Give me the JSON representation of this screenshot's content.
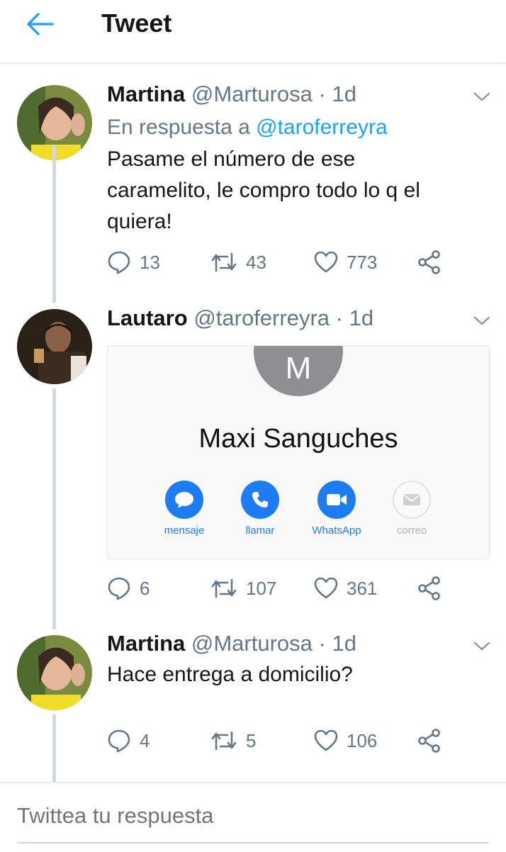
{
  "header": {
    "title": "Tweet"
  },
  "tweets": [
    {
      "name": "Martina",
      "handle": "@Marturosa",
      "dot": "·",
      "time": "1d",
      "reply_prefix": "En respuesta a",
      "reply_handle": "@taroferreyra",
      "lines": [
        "Pasame el número de ese",
        "caramelito, le compro todo lo q el",
        "quiera!"
      ],
      "replies": "13",
      "retweets": "43",
      "likes": "773"
    },
    {
      "name": "Lautaro",
      "handle": "@taroferreyra",
      "dot": "·",
      "time": "1d",
      "card": {
        "initial": "M",
        "contact_name": "Maxi Sanguches",
        "buttons": [
          "mensaje",
          "llamar",
          "WhatsApp",
          "correo"
        ]
      },
      "replies": "6",
      "retweets": "107",
      "likes": "361"
    },
    {
      "name": "Martina",
      "handle": "@Marturosa",
      "dot": "·",
      "time": "1d",
      "lines": [
        "Hace entrega a domicilio?"
      ],
      "replies": "4",
      "retweets": "5",
      "likes": "106"
    }
  ],
  "compose": {
    "placeholder": "Twittea tu respuesta"
  },
  "colors": {
    "accent": "#1da1f2",
    "muted": "#657786",
    "ios_blue": "#1e7cf2"
  }
}
